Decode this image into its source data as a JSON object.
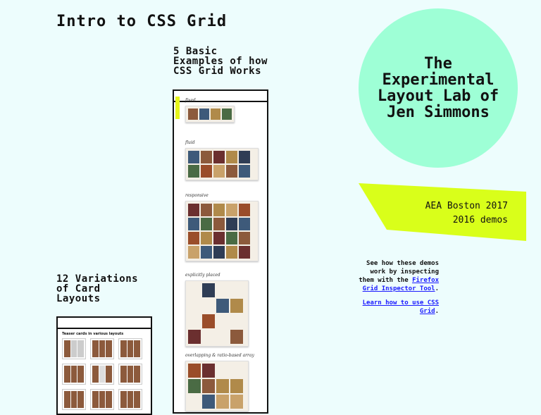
{
  "page_title": "Intro to CSS Grid",
  "grid_section": {
    "title": "5 Basic Examples of how CSS Grid Works",
    "demos": [
      {
        "label": "fixed"
      },
      {
        "label": "fluid"
      },
      {
        "label": "responsive"
      },
      {
        "label": "explicitly placed"
      },
      {
        "label": "overlapping & ratio-based array"
      }
    ]
  },
  "cards_section": {
    "title": "12 Variations of Card Layouts",
    "inner_heading": "Teaser cards in various layouts"
  },
  "lab": {
    "title": "The Experimental Layout Lab of Jen Simmons"
  },
  "event": {
    "line1": "AEA Boston 2017",
    "line2": "2016 demos"
  },
  "info": {
    "text_before": "See how these demos work by inspecting them with the",
    "link1": "Firefox Grid Inspector Tool",
    "text_after": ".",
    "link2": "Learn how to use CSS Grid",
    "text_after2": "."
  },
  "colors": {
    "background": "#edfdfd",
    "circle": "#9effd6",
    "highlight": "#d9ff1a",
    "link": "#1a1aff"
  }
}
